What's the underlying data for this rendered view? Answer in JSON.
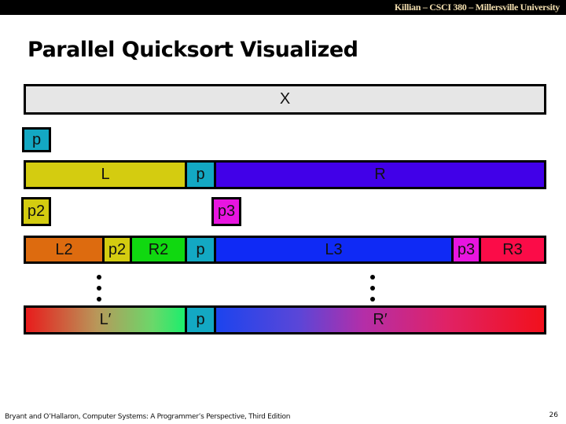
{
  "header": {
    "course_text": "Killian – CSCI 380 – Millersville University"
  },
  "slide": {
    "title": "Parallel Quicksort Visualized"
  },
  "colors": {
    "gray": "#e6e6e6",
    "cyan": "#13a8c3",
    "yellow": "#d4cc10",
    "indigo": "#4100e8",
    "magenta": "#e815e0",
    "orange": "#dd6b0f",
    "green": "#10d810",
    "blue": "#0f2af5",
    "red": "#fb0c48"
  },
  "diagram": {
    "array": {
      "label": "X"
    },
    "pivot": {
      "label": "p"
    },
    "row1": {
      "left": "L",
      "pivot": "p",
      "right": "R"
    },
    "sub_pivots": {
      "left": "p2",
      "right": "p3"
    },
    "row2": {
      "l2": "L2",
      "p2": "p2",
      "r2": "R2",
      "pivot": "p",
      "l3": "L3",
      "p3": "p3",
      "r3": "R3"
    },
    "row3": {
      "left": "L′",
      "pivot": "p",
      "right": "R′"
    }
  },
  "footer": {
    "citation": "Bryant and O’Hallaron, Computer Systems: A Programmer’s Perspective, Third Edition",
    "page_number": "26"
  }
}
